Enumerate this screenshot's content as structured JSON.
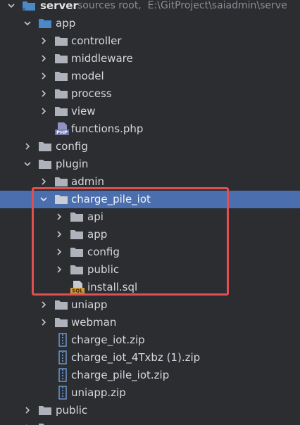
{
  "project": {
    "name": "server",
    "hint_type": "sources root,",
    "hint_path": "E:\\GitProject\\saiadmin\\serve"
  },
  "tree": {
    "app": {
      "label": "app",
      "children": {
        "controller": "controller",
        "middleware": "middleware",
        "model": "model",
        "process": "process",
        "view": "view",
        "functions_php": "functions.php"
      }
    },
    "config": "config",
    "plugin": {
      "label": "plugin",
      "children": {
        "admin": "admin",
        "charge_pile_iot": {
          "label": "charge_pile_iot",
          "children": {
            "api": "api",
            "app": "app",
            "config": "config",
            "public": "public",
            "install_sql": "install.sql"
          }
        },
        "uniapp": "uniapp",
        "webman": "webman",
        "charge_iot_zip": "charge_iot.zip",
        "charge_iot_4txbz_zip": "charge_iot_4Txbz (1).zip",
        "charge_pile_iot_zip": "charge_pile_iot.zip",
        "uniapp_zip": "uniapp.zip"
      }
    },
    "public": "public"
  },
  "icons": {
    "php_badge": "PHP",
    "sql_badge": "SQL"
  },
  "colors": {
    "background": "#2b2d30",
    "selection": "#4b6eaf",
    "highlight_border": "#e05050",
    "folder": "#aeb3bb",
    "module_folder": "#4a88c7",
    "php_icon": "#8f93c4",
    "sql_icon": "#d29a3c",
    "zip_icon": "#6fa0d8"
  }
}
